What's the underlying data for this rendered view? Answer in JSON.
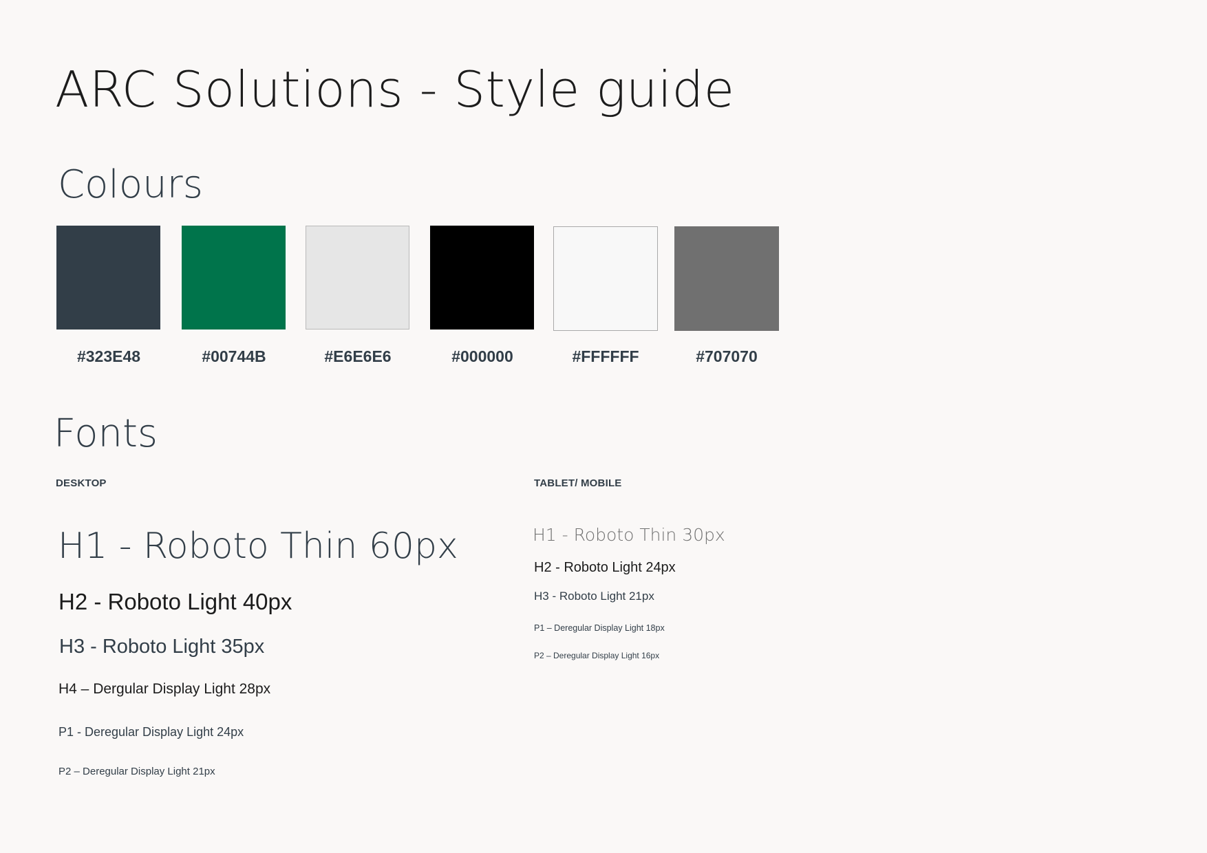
{
  "title": "ARC Solutions - Style guide",
  "colours": {
    "heading": "Colours",
    "swatches": [
      {
        "hex": "#323E48",
        "color": "#323e48"
      },
      {
        "hex": "#00744B",
        "color": "#00744b"
      },
      {
        "hex": "#E6E6E6",
        "color": "#e6e6e6"
      },
      {
        "hex": "#000000",
        "color": "#000000"
      },
      {
        "hex": "#FFFFFF",
        "color": "#f8f8f8"
      },
      {
        "hex": "#707070",
        "color": "#707070"
      }
    ]
  },
  "fonts": {
    "heading": "Fonts",
    "desktop": {
      "label": "DESKTOP",
      "h1": "H1 - Roboto Thin 60px",
      "h2": "H2 - Roboto Light 40px",
      "h3": "H3 - Roboto Light 35px",
      "h4": "H4 – Dergular Display Light 28px",
      "p1": "P1 - Deregular Display Light 24px",
      "p2": "P2 – Deregular Display Light 21px"
    },
    "mobile": {
      "label": "TABLET/ MOBILE",
      "h1": "H1 - Roboto Thin 30px",
      "h2": "H2 - Roboto Light 24px",
      "h3": "H3 - Roboto Light 21px",
      "p1": "P1 – Deregular Display Light 18px",
      "p2": "P2 –  Deregular Display Light 16px"
    }
  }
}
